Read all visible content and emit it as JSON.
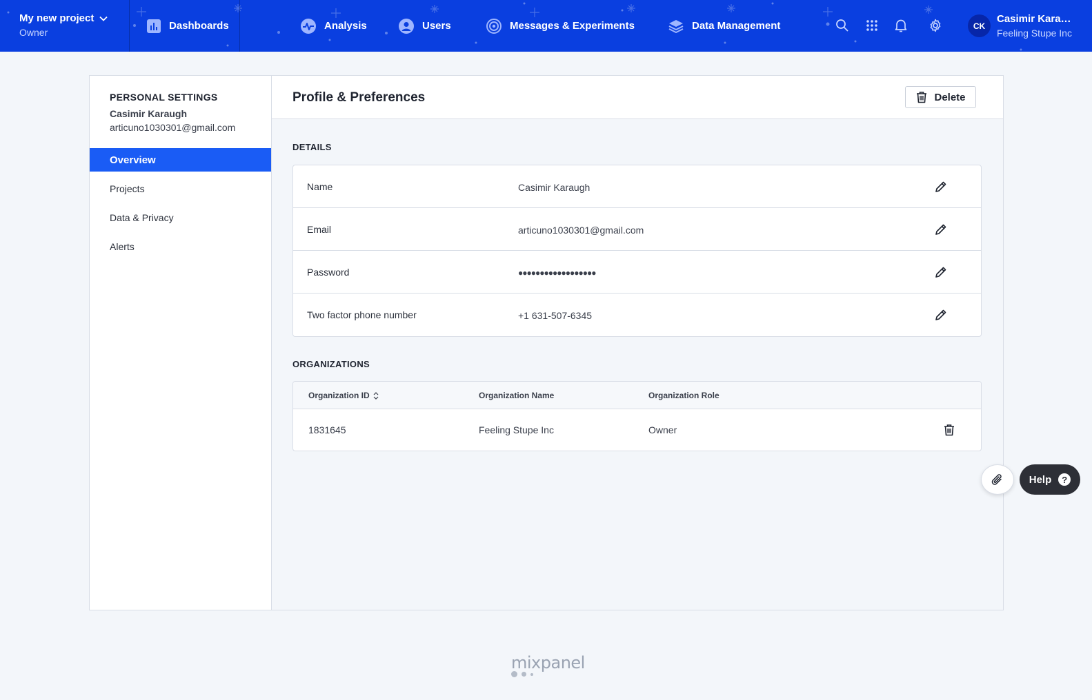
{
  "topnav": {
    "project_name": "My new project",
    "project_role": "Owner",
    "items": [
      {
        "label": "Dashboards",
        "icon": "bar-chart-icon"
      },
      {
        "label": "Analysis",
        "icon": "pulse-icon"
      },
      {
        "label": "Users",
        "icon": "user-circle-icon"
      },
      {
        "label": "Messages & Experiments",
        "icon": "target-icon"
      },
      {
        "label": "Data Management",
        "icon": "layers-icon"
      }
    ],
    "user_initials": "CK",
    "user_name": "Casimir Kara…",
    "user_org": "Feeling Stupe Inc",
    "brand_color": "#0a3fe0"
  },
  "sidebar": {
    "heading": "PERSONAL SETTINGS",
    "name": "Casimir Karaugh",
    "email": "articuno1030301@gmail.com",
    "items": [
      {
        "label": "Overview",
        "active": true
      },
      {
        "label": "Projects",
        "active": false
      },
      {
        "label": "Data & Privacy",
        "active": false
      },
      {
        "label": "Alerts",
        "active": false
      }
    ],
    "active_color": "#1a5cf5"
  },
  "main": {
    "title": "Profile & Preferences",
    "delete_label": "Delete",
    "details_label": "DETAILS",
    "details": [
      {
        "label": "Name",
        "value": "Casimir Karaugh"
      },
      {
        "label": "Email",
        "value": "articuno1030301@gmail.com"
      },
      {
        "label": "Password",
        "value": "●●●●●●●●●●●●●●●●●●"
      },
      {
        "label": "Two factor phone number",
        "value": "+1 631-507-6345"
      }
    ],
    "organizations_label": "ORGANIZATIONS",
    "org_columns": [
      "Organization ID",
      "Organization Name",
      "Organization Role"
    ],
    "org_rows": [
      {
        "id": "1831645",
        "name": "Feeling Stupe Inc",
        "role": "Owner"
      }
    ]
  },
  "floating": {
    "help_label": "Help",
    "help_glyph": "?"
  },
  "footer": {
    "logo_text": "mixpanel"
  }
}
